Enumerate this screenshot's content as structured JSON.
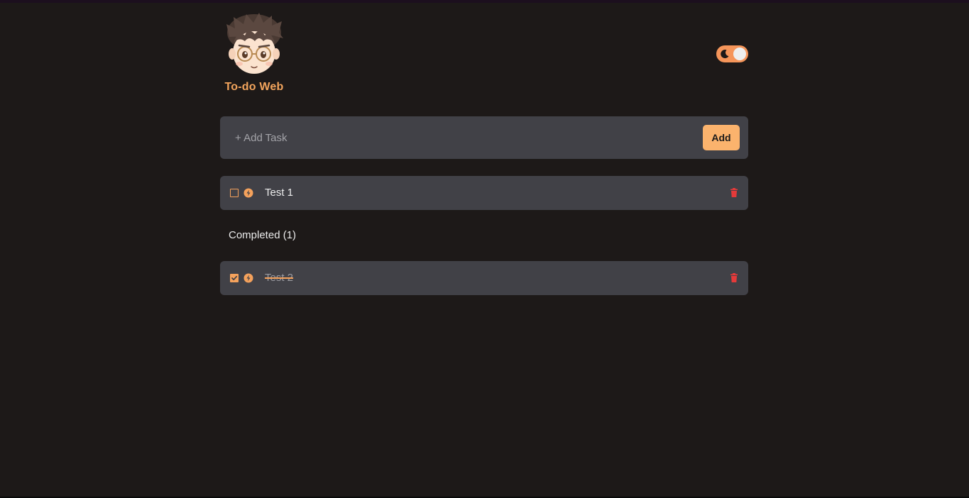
{
  "app": {
    "title": "To-do Web",
    "theme_toggle_icon": "moon-icon",
    "theme": "dark"
  },
  "add_task": {
    "placeholder": "+ Add Task",
    "value": "",
    "button_label": "Add"
  },
  "tasks": [
    {
      "text": "Test 1",
      "completed": false,
      "icon": "bolt-icon"
    }
  ],
  "completed": {
    "heading": "Completed (1)",
    "tasks": [
      {
        "text": "Test 2",
        "completed": true,
        "icon": "bolt-icon"
      }
    ]
  },
  "colors": {
    "background": "#1d1918",
    "card": "#414147",
    "accent": "#f5a25c",
    "add_button": "#fbb36d",
    "delete": "#e53a3a"
  }
}
